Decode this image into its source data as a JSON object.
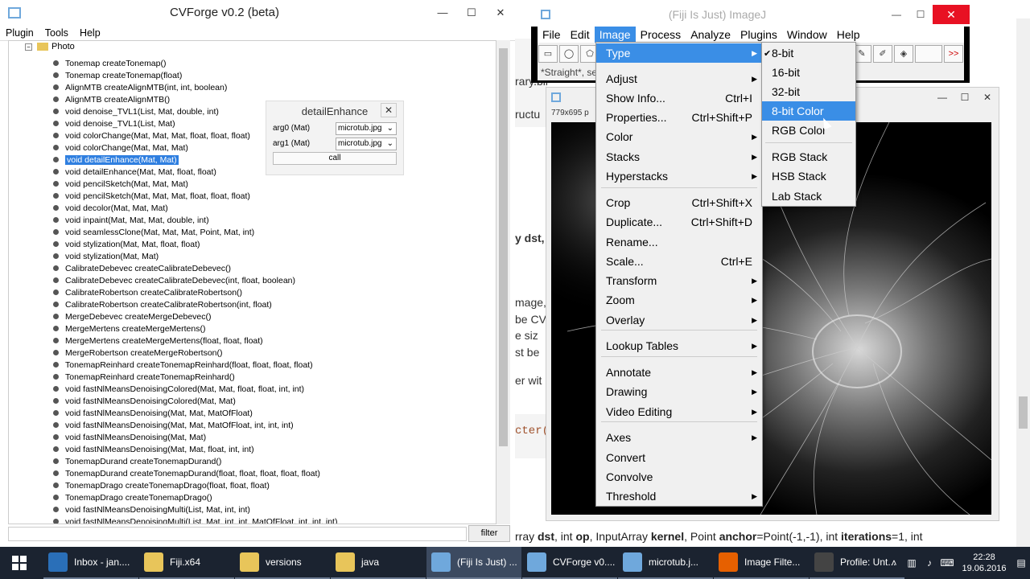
{
  "cvforge": {
    "title": "CVForge v0.2 (beta)",
    "window_buttons": [
      "—",
      "☐",
      "✕"
    ],
    "menu": [
      "Plugin",
      "Tools",
      "Help"
    ],
    "tree_folder": "Photo",
    "tree_items": [
      "Tonemap createTonemap()",
      "Tonemap createTonemap(float)",
      "AlignMTB createAlignMTB(int, int, boolean)",
      "AlignMTB createAlignMTB()",
      "void denoise_TVL1(List, Mat, double, int)",
      "void denoise_TVL1(List, Mat)",
      "void colorChange(Mat, Mat, Mat, float, float, float)",
      "void colorChange(Mat, Mat, Mat)",
      "void detailEnhance(Mat, Mat)",
      "void detailEnhance(Mat, Mat, float, float)",
      "void pencilSketch(Mat, Mat, Mat)",
      "void pencilSketch(Mat, Mat, Mat, float, float, float)",
      "void decolor(Mat, Mat, Mat)",
      "void inpaint(Mat, Mat, Mat, double, int)",
      "void seamlessClone(Mat, Mat, Mat, Point, Mat, int)",
      "void stylization(Mat, Mat, float, float)",
      "void stylization(Mat, Mat)",
      "CalibrateDebevec createCalibrateDebevec()",
      "CalibrateDebevec createCalibrateDebevec(int, float, boolean)",
      "CalibrateRobertson createCalibrateRobertson()",
      "CalibrateRobertson createCalibrateRobertson(int, float)",
      "MergeDebevec createMergeDebevec()",
      "MergeMertens createMergeMertens()",
      "MergeMertens createMergeMertens(float, float, float)",
      "MergeRobertson createMergeRobertson()",
      "TonemapReinhard createTonemapReinhard(float, float, float, float)",
      "TonemapReinhard createTonemapReinhard()",
      "void fastNlMeansDenoisingColored(Mat, Mat, float, float, int, int)",
      "void fastNlMeansDenoisingColored(Mat, Mat)",
      "void fastNlMeansDenoising(Mat, Mat, MatOfFloat)",
      "void fastNlMeansDenoising(Mat, Mat, MatOfFloat, int, int, int)",
      "void fastNlMeansDenoising(Mat, Mat)",
      "void fastNlMeansDenoising(Mat, Mat, float, int, int)",
      "TonemapDurand createTonemapDurand()",
      "TonemapDurand createTonemapDurand(float, float, float, float, float)",
      "TonemapDrago createTonemapDrago(float, float, float)",
      "TonemapDrago createTonemapDrago()",
      "void fastNlMeansDenoisingMulti(List, Mat, int, int)",
      "void fastNlMeansDenoisingMulti(List, Mat, int, int, MatOfFloat, int, int, int)"
    ],
    "selected_index": 8,
    "filter_button": "filter"
  },
  "dialog": {
    "title": "detailEnhance",
    "close": "✕",
    "args": [
      {
        "label": "arg0 (Mat)",
        "value": "microtub.jpg"
      },
      {
        "label": "arg1 (Mat)",
        "value": "microtub.jpg"
      }
    ],
    "call_label": "call"
  },
  "webpage": {
    "fragments": [
      "rary.binary image",
      "ructu",
      "y dst,",
      "mage,",
      "be CV",
      "e siz",
      "st be",
      "er wit",
      "cter()"
    ],
    "bottom_text": {
      "t1": "rray ",
      "b1": "dst",
      "t2": ", int ",
      "b2": "op",
      "t3": ", InputArray ",
      "b3": "kernel",
      "t4": ", Point ",
      "b4": "anchor",
      "t5": "=Point(-1,-1), int ",
      "b5": "iterations",
      "t6": "=1, int"
    }
  },
  "fiji": {
    "title": "(Fiji Is Just) ImageJ",
    "close": "✕",
    "menu": [
      "File",
      "Edit",
      "Image",
      "Process",
      "Analyze",
      "Plugins",
      "Window",
      "Help"
    ],
    "active_menu": "Image",
    "status": "*Straight*, se",
    "more_tools": ">>"
  },
  "image_window": {
    "info": "779x695 p",
    "buttons": [
      "—",
      "☐",
      "✕"
    ]
  },
  "image_menu": {
    "items": [
      {
        "label": "Type",
        "shortcut": "",
        "sub": true,
        "hl": true
      },
      {
        "label": "Adjust",
        "shortcut": "",
        "sub": true
      },
      {
        "label": "Show Info...",
        "shortcut": "Ctrl+I"
      },
      {
        "label": "Properties...",
        "shortcut": "Ctrl+Shift+P"
      },
      {
        "label": "Color",
        "shortcut": "",
        "sub": true
      },
      {
        "label": "Stacks",
        "shortcut": "",
        "sub": true
      },
      {
        "label": "Hyperstacks",
        "shortcut": "",
        "sub": true
      },
      {
        "label": "Crop",
        "shortcut": "Ctrl+Shift+X"
      },
      {
        "label": "Duplicate...",
        "shortcut": "Ctrl+Shift+D"
      },
      {
        "label": "Rename...",
        "shortcut": ""
      },
      {
        "label": "Scale...",
        "shortcut": "Ctrl+E"
      },
      {
        "label": "Transform",
        "shortcut": "",
        "sub": true
      },
      {
        "label": "Zoom",
        "shortcut": "",
        "sub": true
      },
      {
        "label": "Overlay",
        "shortcut": "",
        "sub": true
      },
      {
        "label": "Lookup Tables",
        "shortcut": "",
        "sub": true
      },
      {
        "label": "Annotate",
        "shortcut": "",
        "sub": true
      },
      {
        "label": "Drawing",
        "shortcut": "",
        "sub": true
      },
      {
        "label": "Video Editing",
        "shortcut": "",
        "sub": true
      },
      {
        "label": "Axes",
        "shortcut": "",
        "sub": true
      },
      {
        "label": "Convert",
        "shortcut": ""
      },
      {
        "label": "Convolve",
        "shortcut": ""
      },
      {
        "label": "Threshold",
        "shortcut": "",
        "sub": true
      }
    ]
  },
  "type_menu": {
    "items": [
      {
        "label": "8-bit",
        "checked": true
      },
      {
        "label": "16-bit"
      },
      {
        "label": "32-bit"
      },
      {
        "label": "8-bit Color",
        "hl": true
      },
      {
        "label": "RGB Color"
      },
      {
        "label": "RGB Stack"
      },
      {
        "label": "HSB Stack"
      },
      {
        "label": "Lab Stack"
      }
    ]
  },
  "taskbar": {
    "items": [
      {
        "label": "Inbox - jan....",
        "color": "#2a6fb8"
      },
      {
        "label": "Fiji.x64",
        "color": "#e8c55a"
      },
      {
        "label": "versions",
        "color": "#e8c55a"
      },
      {
        "label": "java",
        "color": "#e8c55a"
      },
      {
        "label": "(Fiji Is Just) ...",
        "color": "#6fa8dc",
        "active": true
      },
      {
        "label": "CVForge v0....",
        "color": "#6fa8dc"
      },
      {
        "label": "microtub.j...",
        "color": "#6fa8dc"
      },
      {
        "label": "Image Filte...",
        "color": "#e66000"
      },
      {
        "label": "Profile: Unt...",
        "color": "#444"
      }
    ],
    "time": "22:28",
    "date": "19.06.2016"
  },
  "colors": {
    "highlight": "#3a8ee6",
    "selection": "#2f7fe0",
    "close_red": "#e81123",
    "taskbar": "#1b2330"
  }
}
